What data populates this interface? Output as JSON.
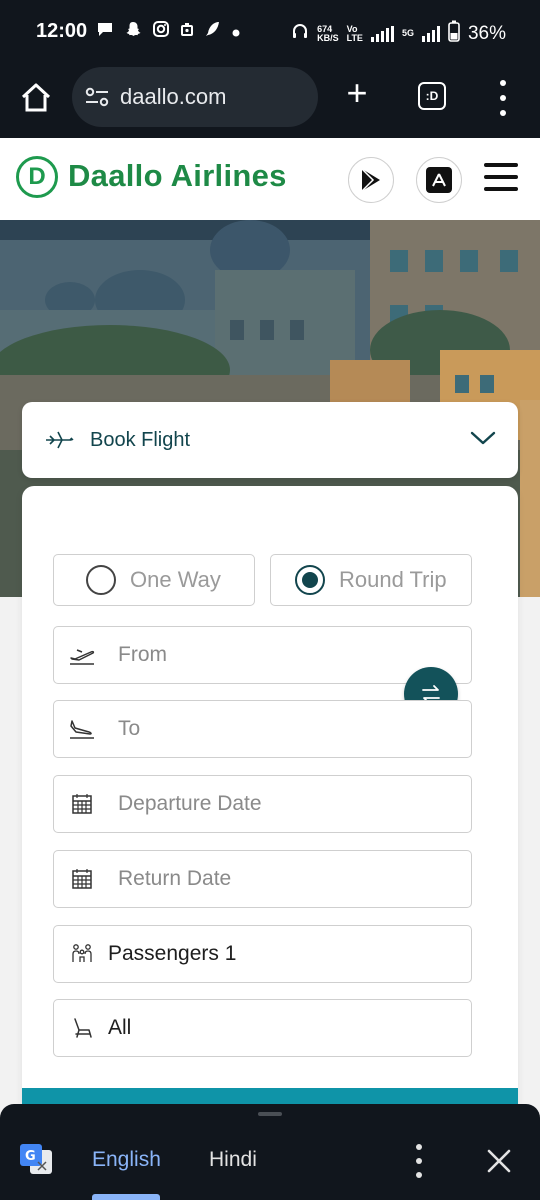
{
  "status_bar": {
    "time": "12:00",
    "net_speed_value": "674",
    "net_speed_unit": "KB/S",
    "volte_top": "Vo",
    "volte_bottom": "LTE",
    "net_type": "5G",
    "battery": "36%"
  },
  "browser": {
    "url": "daallo.com",
    "tabs_label": ":D",
    "new_tab_label": "+"
  },
  "site": {
    "brand": "Daallo Airlines",
    "logo_letter": "D",
    "brand_color": "#1e8a46"
  },
  "booking": {
    "section_label": "Book Flight",
    "trip_types": {
      "one_way": "One Way",
      "round_trip": "Round Trip",
      "selected": "Round Trip"
    },
    "from_placeholder": "From",
    "to_placeholder": "To",
    "departure_placeholder": "Departure Date",
    "return_placeholder": "Return Date",
    "passengers_label": "Passengers 1",
    "class_label": "All",
    "accent_color": "#13525a"
  },
  "translate_bar": {
    "source_lang": "English",
    "target_lang": "Hindi"
  }
}
